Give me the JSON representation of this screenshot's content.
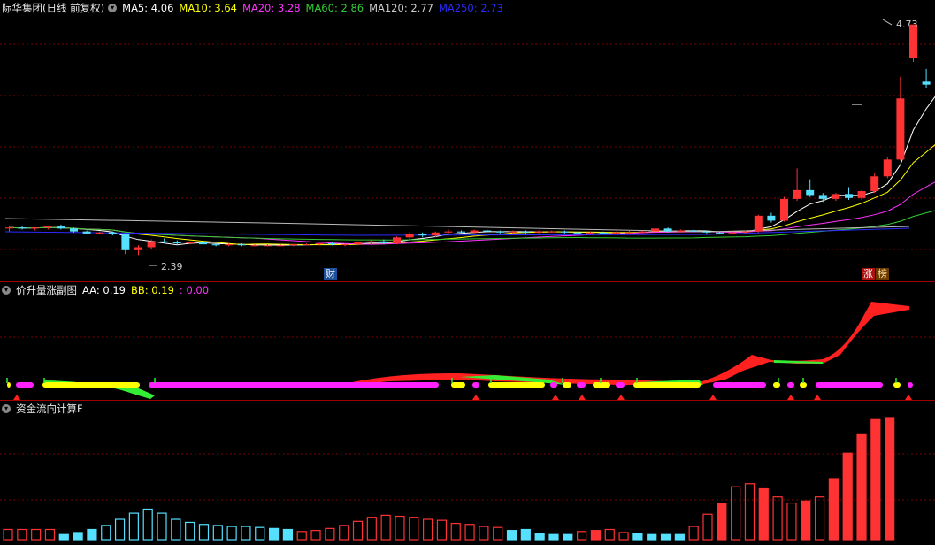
{
  "main": {
    "title": "际华集团(日线 前复权)",
    "ma": [
      {
        "label": "MA5: 4.06",
        "color": "#ffffff"
      },
      {
        "label": "MA10: 3.64",
        "color": "#ffff00"
      },
      {
        "label": "MA20: 3.28",
        "color": "#ff33ff"
      },
      {
        "label": "MA60: 2.86",
        "color": "#33cc33"
      },
      {
        "label": "MA120: 2.77",
        "color": "#cccccc"
      },
      {
        "label": "MA250: 2.73",
        "color": "#2a2aff"
      }
    ],
    "high_label": "4.73",
    "low_label": "2.39",
    "tag_cai": "财",
    "tag_zhang": "涨",
    "tag_bang": "榜"
  },
  "sub1": {
    "title": "价升量涨副图",
    "aa": "AA: 0.19",
    "bb": "BB: 0.19",
    "cc": ": 0.00"
  },
  "sub2": {
    "title": "资金流向计算F"
  },
  "colors": {
    "up": "#ff3333",
    "down": "#55e0ff",
    "grid": "#7a0000"
  },
  "chart_data": {
    "type": "candlestick",
    "candles": [
      [
        2.66,
        2.68,
        2.63,
        2.67
      ],
      [
        2.67,
        2.69,
        2.65,
        2.66
      ],
      [
        2.66,
        2.67,
        2.64,
        2.67
      ],
      [
        2.67,
        2.69,
        2.65,
        2.68
      ],
      [
        2.68,
        2.7,
        2.65,
        2.66
      ],
      [
        2.66,
        2.67,
        2.62,
        2.63
      ],
      [
        2.63,
        2.64,
        2.6,
        2.61
      ],
      [
        2.61,
        2.63,
        2.6,
        2.62
      ],
      [
        2.62,
        2.63,
        2.59,
        2.6
      ],
      [
        2.6,
        2.61,
        2.4,
        2.44
      ],
      [
        2.44,
        2.49,
        2.39,
        2.47
      ],
      [
        2.47,
        2.55,
        2.45,
        2.53
      ],
      [
        2.53,
        2.56,
        2.51,
        2.52
      ],
      [
        2.52,
        2.54,
        2.5,
        2.51
      ],
      [
        2.51,
        2.53,
        2.5,
        2.52
      ],
      [
        2.52,
        2.53,
        2.49,
        2.5
      ],
      [
        2.5,
        2.51,
        2.48,
        2.49
      ],
      [
        2.49,
        2.51,
        2.48,
        2.5
      ],
      [
        2.5,
        2.51,
        2.48,
        2.49
      ],
      [
        2.49,
        2.5,
        2.48,
        2.49
      ],
      [
        2.49,
        2.5,
        2.48,
        2.49
      ],
      [
        2.49,
        2.5,
        2.48,
        2.49
      ],
      [
        2.49,
        2.5,
        2.48,
        2.5
      ],
      [
        2.5,
        2.51,
        2.49,
        2.5
      ],
      [
        2.5,
        2.51,
        2.49,
        2.51
      ],
      [
        2.51,
        2.52,
        2.49,
        2.5
      ],
      [
        2.5,
        2.51,
        2.48,
        2.5
      ],
      [
        2.5,
        2.53,
        2.49,
        2.52
      ],
      [
        2.52,
        2.55,
        2.5,
        2.53
      ],
      [
        2.53,
        2.55,
        2.5,
        2.51
      ],
      [
        2.51,
        2.58,
        2.5,
        2.57
      ],
      [
        2.57,
        2.62,
        2.55,
        2.6
      ],
      [
        2.6,
        2.62,
        2.57,
        2.59
      ],
      [
        2.59,
        2.63,
        2.57,
        2.62
      ],
      [
        2.62,
        2.65,
        2.6,
        2.63
      ],
      [
        2.63,
        2.64,
        2.61,
        2.62
      ],
      [
        2.62,
        2.65,
        2.61,
        2.64
      ],
      [
        2.64,
        2.65,
        2.62,
        2.63
      ],
      [
        2.63,
        2.64,
        2.61,
        2.62
      ],
      [
        2.62,
        2.64,
        2.61,
        2.63
      ],
      [
        2.63,
        2.64,
        2.61,
        2.62
      ],
      [
        2.62,
        2.64,
        2.61,
        2.63
      ],
      [
        2.63,
        2.64,
        2.62,
        2.63
      ],
      [
        2.63,
        2.64,
        2.61,
        2.62
      ],
      [
        2.62,
        2.63,
        2.6,
        2.61
      ],
      [
        2.61,
        2.63,
        2.6,
        2.62
      ],
      [
        2.62,
        2.63,
        2.6,
        2.61
      ],
      [
        2.61,
        2.63,
        2.6,
        2.62
      ],
      [
        2.62,
        2.64,
        2.61,
        2.62
      ],
      [
        2.62,
        2.64,
        2.61,
        2.63
      ],
      [
        2.63,
        2.68,
        2.62,
        2.66
      ],
      [
        2.66,
        2.67,
        2.62,
        2.63
      ],
      [
        2.63,
        2.65,
        2.62,
        2.64
      ],
      [
        2.64,
        2.65,
        2.62,
        2.63
      ],
      [
        2.63,
        2.64,
        2.61,
        2.62
      ],
      [
        2.62,
        2.63,
        2.6,
        2.61
      ],
      [
        2.61,
        2.63,
        2.6,
        2.62
      ],
      [
        2.62,
        2.64,
        2.61,
        2.63
      ],
      [
        2.63,
        2.8,
        2.62,
        2.79
      ],
      [
        2.79,
        2.82,
        2.72,
        2.74
      ],
      [
        2.74,
        2.98,
        2.73,
        2.96
      ],
      [
        2.96,
        3.27,
        2.94,
        3.05
      ],
      [
        3.05,
        3.16,
        2.98,
        3.0
      ],
      [
        3.0,
        3.02,
        2.93,
        2.96
      ],
      [
        2.96,
        3.02,
        2.94,
        3.01
      ],
      [
        3.01,
        3.08,
        2.95,
        2.97
      ],
      [
        2.97,
        3.05,
        2.95,
        3.04
      ],
      [
        3.04,
        3.22,
        3.02,
        3.19
      ],
      [
        3.19,
        3.38,
        3.17,
        3.36
      ],
      [
        3.36,
        4.2,
        3.35,
        3.98
      ],
      [
        4.39,
        4.73,
        4.35,
        4.73
      ],
      [
        4.15,
        4.28,
        4.09,
        4.12
      ],
      [
        4.19,
        4.32,
        4.04,
        4.08
      ]
    ],
    "volume": [
      [
        1,
        "up"
      ],
      [
        1,
        "up"
      ],
      [
        1,
        "up"
      ],
      [
        1,
        "up"
      ],
      [
        0.5,
        "down"
      ],
      [
        0.7,
        "down"
      ],
      [
        1,
        "down"
      ],
      [
        1.4,
        "down"
      ],
      [
        2,
        "down"
      ],
      [
        2.6,
        "down"
      ],
      [
        3,
        "down"
      ],
      [
        2.6,
        "down"
      ],
      [
        2,
        "down"
      ],
      [
        1.7,
        "down"
      ],
      [
        1.5,
        "down"
      ],
      [
        1.4,
        "down"
      ],
      [
        1.3,
        "down"
      ],
      [
        1.3,
        "down"
      ],
      [
        1.2,
        "down"
      ],
      [
        1.1,
        "down"
      ],
      [
        1,
        "down"
      ],
      [
        0.8,
        "up"
      ],
      [
        0.9,
        "up"
      ],
      [
        1.1,
        "up"
      ],
      [
        1.4,
        "up"
      ],
      [
        1.8,
        "up"
      ],
      [
        2.2,
        "up"
      ],
      [
        2.4,
        "up"
      ],
      [
        2.3,
        "up"
      ],
      [
        2.2,
        "up"
      ],
      [
        2.0,
        "up"
      ],
      [
        1.9,
        "up"
      ],
      [
        1.6,
        "up"
      ],
      [
        1.5,
        "up"
      ],
      [
        1.3,
        "up"
      ],
      [
        1.2,
        "up"
      ],
      [
        0.9,
        "down"
      ],
      [
        1.0,
        "down"
      ],
      [
        0.6,
        "down"
      ],
      [
        0.5,
        "down"
      ],
      [
        0.5,
        "down"
      ],
      [
        0.8,
        "up"
      ],
      [
        0.9,
        "up"
      ],
      [
        1.0,
        "up"
      ],
      [
        0.7,
        "up"
      ],
      [
        0.6,
        "down"
      ],
      [
        0.5,
        "down"
      ],
      [
        0.5,
        "down"
      ],
      [
        0.5,
        "down"
      ],
      [
        1.3,
        "up"
      ],
      [
        2.5,
        "up"
      ],
      [
        3.6,
        "up"
      ],
      [
        5.2,
        "up"
      ],
      [
        5.5,
        "up"
      ],
      [
        5.0,
        "up"
      ],
      [
        4.2,
        "up"
      ],
      [
        3.6,
        "up"
      ],
      [
        3.8,
        "up"
      ],
      [
        4.2,
        "up"
      ],
      [
        6.0,
        "up"
      ],
      [
        8.5,
        "up"
      ],
      [
        10.4,
        "up"
      ],
      [
        11.8,
        "up"
      ],
      [
        12.0,
        "up"
      ]
    ]
  }
}
